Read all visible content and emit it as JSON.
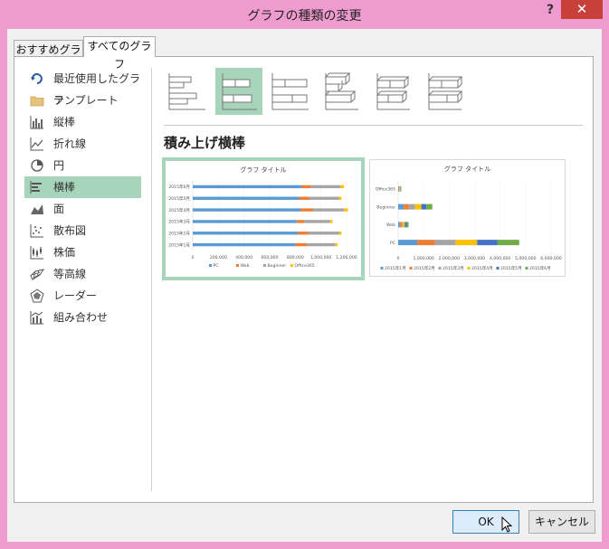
{
  "window": {
    "title": "グラフの種類の変更",
    "help": "?",
    "close": "✕"
  },
  "tabs": [
    {
      "label": "おすすめグラフ"
    },
    {
      "label": "すべてのグラフ"
    }
  ],
  "sidebar": {
    "items": [
      {
        "label": "最近使用したグラフ",
        "icon": "recent-icon"
      },
      {
        "label": "テンプレート",
        "icon": "folder-icon"
      },
      {
        "label": "縦棒",
        "icon": "column-chart-icon"
      },
      {
        "label": "折れ線",
        "icon": "line-chart-icon"
      },
      {
        "label": "円",
        "icon": "pie-chart-icon"
      },
      {
        "label": "横棒",
        "icon": "bar-chart-icon",
        "selected": true
      },
      {
        "label": "面",
        "icon": "area-chart-icon"
      },
      {
        "label": "散布図",
        "icon": "scatter-chart-icon"
      },
      {
        "label": "株価",
        "icon": "stock-chart-icon"
      },
      {
        "label": "等高線",
        "icon": "surface-chart-icon"
      },
      {
        "label": "レーダー",
        "icon": "radar-chart-icon"
      },
      {
        "label": "組み合わせ",
        "icon": "combo-chart-icon"
      }
    ]
  },
  "subtypes": [
    "clustered-bar",
    "stacked-bar",
    "100-stacked-bar",
    "3d-clustered-bar",
    "3d-stacked-bar",
    "3d-100-stacked-bar"
  ],
  "selected_type_name": "積み上げ横棒",
  "colors": {
    "accent": "#a7d5bb",
    "s1": "#5b9bd5",
    "s2": "#ed7d31",
    "s3": "#a5a5a5",
    "s4": "#ffc000",
    "s5": "#4472c4",
    "s6": "#70ad47"
  },
  "buttons": {
    "ok": "OK",
    "cancel": "キャンセル"
  },
  "chart_data": [
    {
      "type": "bar",
      "title": "グラフ タイトル",
      "categories": [
        "2015年1月",
        "2015年2月",
        "2015年3月",
        "2015年4月",
        "2015年5月",
        "2015年6月"
      ],
      "series": [
        {
          "name": "PC",
          "values": [
            800000,
            820000,
            810000,
            840000,
            830000,
            850000
          ]
        },
        {
          "name": "Web",
          "values": [
            90000,
            80000,
            60000,
            100000,
            80000,
            70000
          ]
        },
        {
          "name": "Beginner",
          "values": [
            220000,
            240000,
            200000,
            240000,
            230000,
            230000
          ]
        },
        {
          "name": "Office365",
          "values": [
            20000,
            20000,
            20000,
            30000,
            20000,
            30000
          ]
        }
      ],
      "x_ticks": [
        "0",
        "200,000",
        "400,000",
        "600,000",
        "800,000",
        "1,000,000",
        "1,200,000"
      ],
      "xlim": [
        0,
        1200000
      ]
    },
    {
      "type": "bar",
      "title": "グラフ タイトル",
      "categories": [
        "PC",
        "Web",
        "Beginner",
        "Office365"
      ],
      "series": [
        {
          "name": "2015年1月",
          "values": [
            750000,
            60000,
            220000,
            20000
          ]
        },
        {
          "name": "2015年2月",
          "values": [
            700000,
            70000,
            200000,
            20000
          ]
        },
        {
          "name": "2015年3月",
          "values": [
            800000,
            50000,
            240000,
            20000
          ]
        },
        {
          "name": "2015年4月",
          "values": [
            850000,
            80000,
            250000,
            20000
          ]
        },
        {
          "name": "2015年5月",
          "values": [
            800000,
            80000,
            200000,
            20000
          ]
        },
        {
          "name": "2015年6月",
          "values": [
            850000,
            70000,
            230000,
            20000
          ]
        }
      ],
      "x_ticks": [
        "0",
        "1,000,000",
        "2,000,000",
        "3,000,000",
        "4,000,000",
        "5,000,000",
        "6,000,000"
      ],
      "xlim": [
        0,
        6000000
      ]
    }
  ]
}
